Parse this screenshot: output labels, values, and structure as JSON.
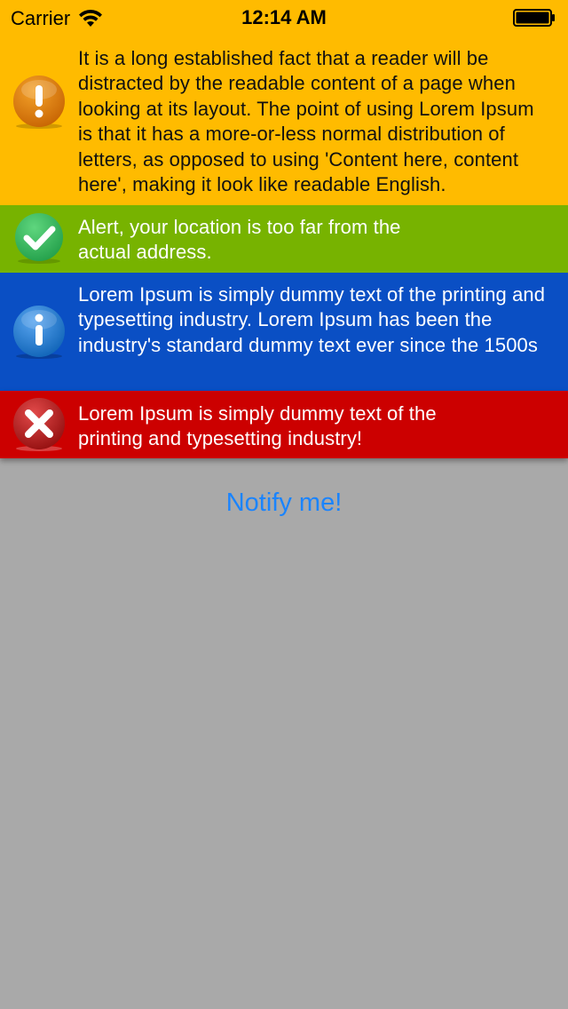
{
  "status_bar": {
    "carrier": "Carrier",
    "time": "12:14 AM"
  },
  "notifications": [
    {
      "type": "warning",
      "icon": "exclamation-icon",
      "color": "#ffbb00",
      "message": "It is a long established fact that a reader will be distracted by the readable content of a page when looking at its layout. The point of using Lorem Ipsum is that it has a more-or-less normal distribution of letters, as opposed to using 'Content here, content here', making it look like readable English."
    },
    {
      "type": "success",
      "icon": "checkmark-icon",
      "color": "#77b300",
      "message": "Alert, your location is too far from the actual address."
    },
    {
      "type": "info",
      "icon": "info-icon",
      "color": "#0a4fc4",
      "message": "Lorem Ipsum is simply dummy text of the printing and typesetting industry. Lorem Ipsum has been the industry's standard dummy text ever since the 1500s"
    },
    {
      "type": "error",
      "icon": "close-icon",
      "color": "#cc0000",
      "message": "Lorem Ipsum is simply dummy text of the printing and typesetting industry!"
    }
  ],
  "notify_button": {
    "label": "Notify me!",
    "color": "#1a84ff"
  },
  "background_color": "#a9a9a9"
}
